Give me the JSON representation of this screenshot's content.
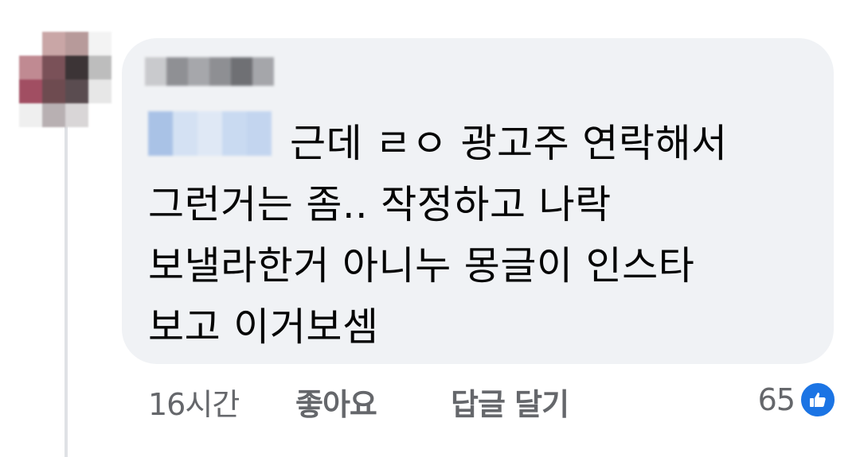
{
  "comment": {
    "lines": [
      "근데 ㄹㅇ 광고주 연락해서",
      "그런거는 좀.. 작정하고 나락",
      "보낼라한거 아니누 몽글이 인스타",
      "보고 이거보셈"
    ]
  },
  "actions": {
    "time": "16시간",
    "like_label": "좋아요",
    "reply_label": "답글 달기"
  },
  "reactions": {
    "count": "65",
    "icon": "thumbs-up-icon"
  },
  "colors": {
    "bubble": "#f0f2f5",
    "text": "#050505",
    "secondary": "#65676b",
    "like_blue": "#1b74e4"
  }
}
